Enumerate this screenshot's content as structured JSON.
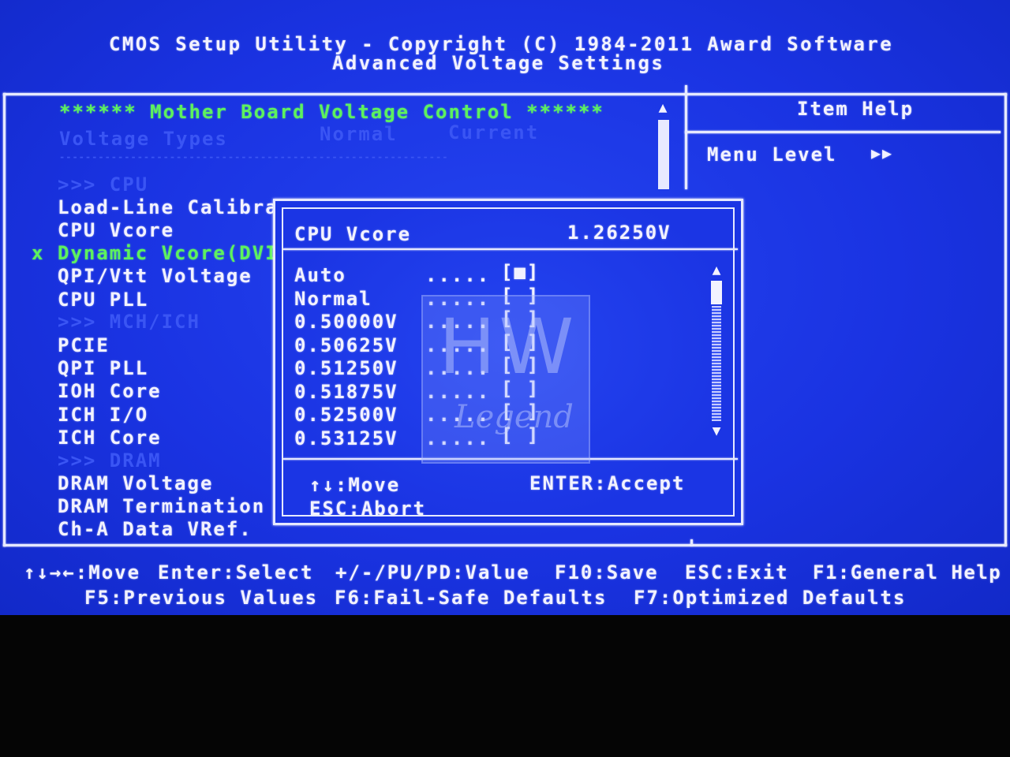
{
  "header": {
    "title": "CMOS Setup Utility - Copyright (C) 1984-2011 Award Software",
    "subtitle": "Advanced Voltage Settings"
  },
  "main": {
    "section_title": "****** Mother Board Voltage Control ******",
    "columns": {
      "types": "Voltage Types",
      "normal": "Normal",
      "current": "Current"
    },
    "divider": "------------------------------------------------------------",
    "items": [
      {
        "label": ">>> CPU",
        "style": "dim"
      },
      {
        "label": "Load-Line Calibra",
        "style": "normal"
      },
      {
        "label": "CPU Vcore",
        "style": "normal"
      },
      {
        "label": "Dynamic Vcore(DVI",
        "style": "green",
        "marker": "x"
      },
      {
        "label": "QPI/Vtt Voltage",
        "style": "normal"
      },
      {
        "label": "CPU PLL",
        "style": "normal"
      },
      {
        "label": ">>> MCH/ICH",
        "style": "dim"
      },
      {
        "label": "PCIE",
        "style": "normal"
      },
      {
        "label": "QPI PLL",
        "style": "normal"
      },
      {
        "label": "IOH Core",
        "style": "normal"
      },
      {
        "label": "ICH I/O",
        "style": "normal"
      },
      {
        "label": "ICH Core",
        "style": "normal"
      },
      {
        "label": ">>> DRAM",
        "style": "dim"
      },
      {
        "label": "DRAM Voltage",
        "style": "normal"
      },
      {
        "label": "DRAM Termination",
        "style": "normal"
      },
      {
        "label": "Ch-A Data VRef.",
        "style": "normal"
      }
    ]
  },
  "help": {
    "title": "Item Help",
    "menu_level_label": "Menu Level",
    "menu_level_arrows": "▶▶"
  },
  "popup": {
    "title": "CPU Vcore",
    "value": "1.26250V",
    "options": [
      {
        "label": "Auto",
        "dots": ".....",
        "check": "[■]"
      },
      {
        "label": "Normal",
        "dots": ".....",
        "check": "[ ]"
      },
      {
        "label": "0.50000V",
        "dots": ".....",
        "check": "[ ]"
      },
      {
        "label": "0.50625V",
        "dots": ".....",
        "check": "[ ]"
      },
      {
        "label": "0.51250V",
        "dots": ".....",
        "check": "[ ]"
      },
      {
        "label": "0.51875V",
        "dots": ".....",
        "check": "[ ]"
      },
      {
        "label": "0.52500V",
        "dots": ".....",
        "check": "[ ]"
      },
      {
        "label": "0.53125V",
        "dots": ".....",
        "check": "[ ]"
      }
    ],
    "hint_move": "↑↓:Move",
    "hint_accept": "ENTER:Accept",
    "hint_abort": "ESC:Abort"
  },
  "watermark": {
    "big": "HW",
    "small": "egend"
  },
  "footer": {
    "row1": [
      "↑↓→←:Move",
      "Enter:Select",
      "+/-/PU/PD:Value",
      "F10:Save",
      "ESC:Exit",
      "F1:General Help"
    ],
    "row2": [
      "F5:Previous Values",
      "F6:Fail-Safe Defaults",
      "F7:Optimized Defaults"
    ]
  },
  "colors": {
    "background": "#1a33e6",
    "text": "#f2f2ff",
    "highlight": "#5df25d",
    "disabled": "#3a55f4",
    "bezel": "#050505"
  }
}
